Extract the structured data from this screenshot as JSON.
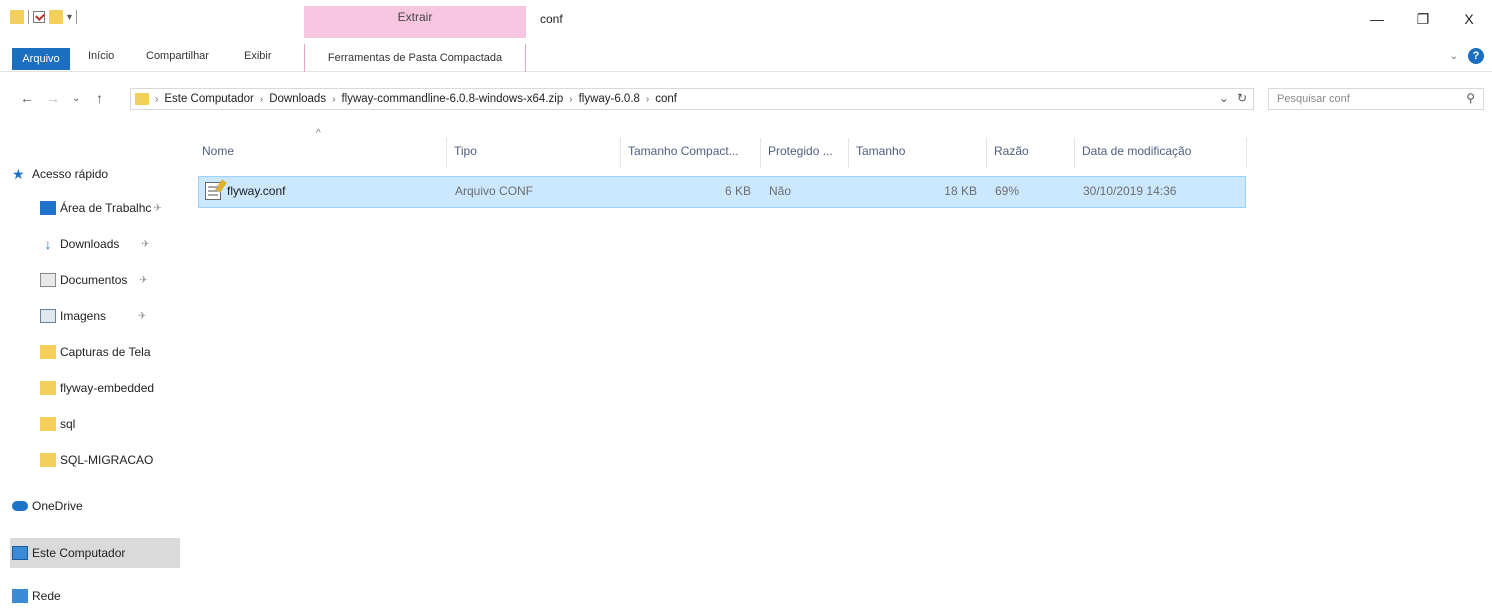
{
  "titlebar": {
    "context_tab": "Extrair",
    "title": "conf",
    "controls": {
      "minimize": "—",
      "restore": "❐",
      "close": "X"
    }
  },
  "ribbon": {
    "tabs": [
      "Arquivo",
      "Início",
      "Compartilhar",
      "Exibir",
      "Ferramentas de Pasta Compactada"
    ],
    "help": "?"
  },
  "address": {
    "breadcrumb": [
      "Este Computador",
      "Downloads",
      "flyway-commandline-6.0.8-windows-x64.zip",
      "flyway-6.0.8",
      "conf"
    ],
    "search_placeholder": "Pesquisar conf"
  },
  "sidebar": {
    "quick_access": "Acesso rápido",
    "items": [
      {
        "label": "Área de Trabalhc",
        "icon": "desktop-icon",
        "pinned": true
      },
      {
        "label": "Downloads",
        "icon": "download-icon",
        "pinned": true
      },
      {
        "label": "Documentos",
        "icon": "document-icon",
        "pinned": true
      },
      {
        "label": "Imagens",
        "icon": "image-icon",
        "pinned": true
      },
      {
        "label": "Capturas de Tela",
        "icon": "folder-icon",
        "pinned": false
      },
      {
        "label": "flyway-embedded",
        "icon": "folder-icon",
        "pinned": false
      },
      {
        "label": "sql",
        "icon": "folder-icon",
        "pinned": false
      },
      {
        "label": "SQL-MIGRACAO",
        "icon": "folder-icon",
        "pinned": false
      }
    ],
    "onedrive": "OneDrive",
    "this_pc": "Este Computador",
    "network": "Rede"
  },
  "columns": [
    "Nome",
    "Tipo",
    "Tamanho Compact...",
    "Protegido ...",
    "Tamanho",
    "Razão",
    "Data de modificação"
  ],
  "files": [
    {
      "name": "flyway.conf",
      "type": "Arquivo CONF",
      "compressed": "6 KB",
      "protected": "Não",
      "size": "18 KB",
      "ratio": "69%",
      "modified": "30/10/2019 14:36"
    }
  ],
  "colors": {
    "accent": "#1c6ec0",
    "context_tab": "#f7c6e0",
    "selection": "#cce8ff"
  }
}
